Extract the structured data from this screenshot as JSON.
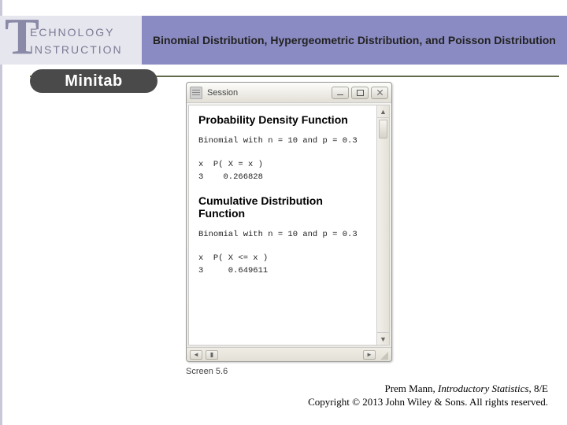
{
  "header": {
    "tech_line1": "ECHNOLOGY",
    "tech_line2": "INSTRUCTION",
    "topic": "Binomial Distribution, Hypergeometric Distribution, and Poisson Distribution",
    "software": "Minitab"
  },
  "window": {
    "title": "Session",
    "pdf_heading": "Probability Density Function",
    "pdf_params": "Binomial with n = 10 and p = 0.3",
    "pdf_table": "x  P( X = x )\n3    0.266828",
    "cdf_heading": "Cumulative Distribution Function",
    "cdf_params": "Binomial with n = 10 and p = 0.3",
    "cdf_table": "x  P( X <= x )\n3     0.649611"
  },
  "caption": "Screen 5.6",
  "footer": {
    "line1_author": "Prem Mann, ",
    "line1_title": "Introductory Statistics",
    "line1_edition": ", 8/E",
    "line2": "Copyright © 2013 John Wiley & Sons. All rights reserved."
  }
}
